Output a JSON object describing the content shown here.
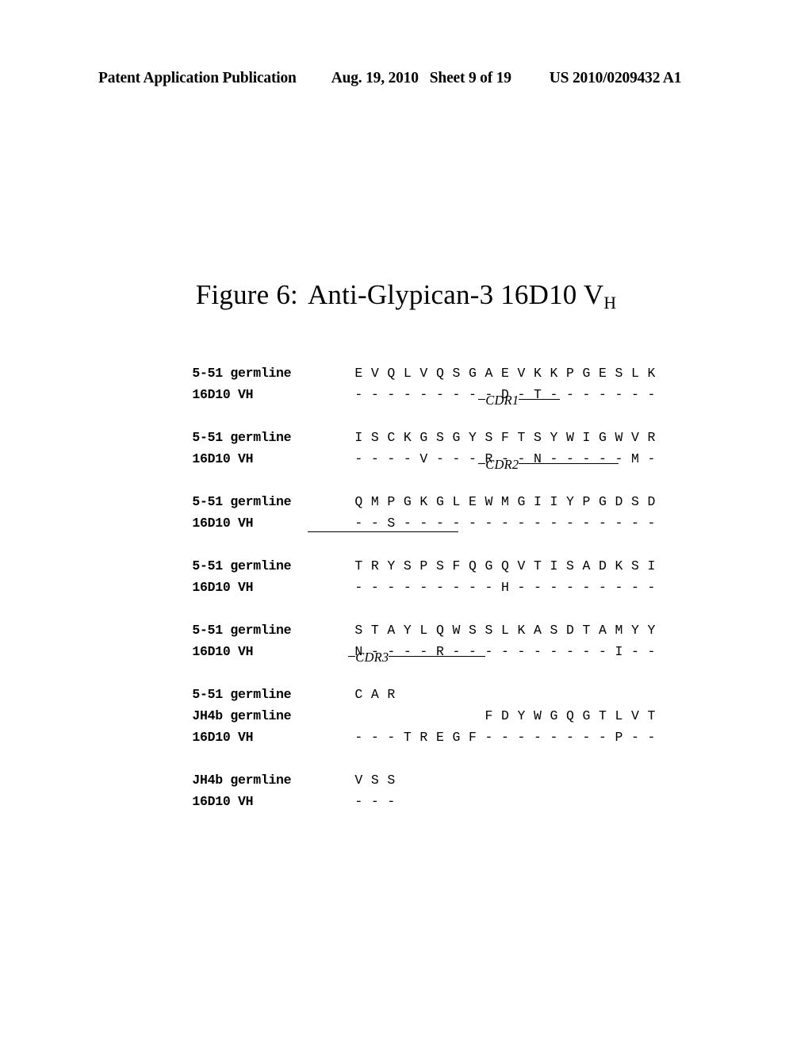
{
  "header": {
    "publication": "Patent Application Publication",
    "date": "Aug. 19, 2010",
    "sheet": "Sheet 9 of 19",
    "doc_number": "US 2010/0209432 A1"
  },
  "figure": {
    "label": "Figure 6:",
    "title": "Anti-Glypican-3 16D10 V",
    "subscript": "H"
  },
  "labels": {
    "germline_5_51": "5-51 germline",
    "vh_16d10": "16D10 VH",
    "jh4b_germline": "JH4b germline"
  },
  "cdr": {
    "cdr1": "CDR1",
    "cdr2": "CDR2",
    "cdr3": "CDR3"
  },
  "blocks": [
    {
      "id": "block-1",
      "rows": [
        {
          "label": "5-51 germline",
          "seq": "E V Q L V Q S G A E V K K P G E S L K"
        },
        {
          "label": "16D10 VH",
          "seq": "- - - - - - - - - D - T - - - - - - -"
        }
      ]
    },
    {
      "id": "block-2",
      "cdr_label": "CDR1",
      "rows": [
        {
          "label": "5-51 germline",
          "seq": "I S C K G S G Y S F T S Y W I G W V R"
        },
        {
          "label": "16D10 VH",
          "seq": "- - - - V - - - R - - N - - - - - M -"
        }
      ]
    },
    {
      "id": "block-3",
      "cdr_label": "CDR2",
      "rows": [
        {
          "label": "5-51 germline",
          "seq": "Q M P G K G L E W M G I I Y P G D S D"
        },
        {
          "label": "16D10 VH",
          "seq": "- - S - - - - - - - - - - - - - - - -"
        }
      ]
    },
    {
      "id": "block-4",
      "rows": [
        {
          "label": "5-51 germline",
          "seq": "T R Y S P S F Q G Q V T I S A D K S I"
        },
        {
          "label": "16D10 VH",
          "seq": "- - - - - - - - - H - - - - - - - - -"
        }
      ]
    },
    {
      "id": "block-5",
      "rows": [
        {
          "label": "5-51 germline",
          "seq": "S T A Y L Q W S S L K A S D T A M Y Y"
        },
        {
          "label": "16D10 VH",
          "seq": "N - - - - R - - - - - - - - - - I - -"
        }
      ]
    },
    {
      "id": "block-6",
      "cdr_label": "CDR3",
      "rows": [
        {
          "label": "5-51 germline",
          "seq": "C A R"
        },
        {
          "label": "JH4b germline",
          "seq": "                F D Y W G Q G T L V T"
        },
        {
          "label": "16D10 VH",
          "seq": "- - - T R E G F - - - - - - - - P - -"
        }
      ]
    },
    {
      "id": "block-7",
      "rows": [
        {
          "label": "JH4b germline",
          "seq": "V S S"
        },
        {
          "label": "16D10 VH",
          "seq": "- - -"
        }
      ]
    }
  ]
}
